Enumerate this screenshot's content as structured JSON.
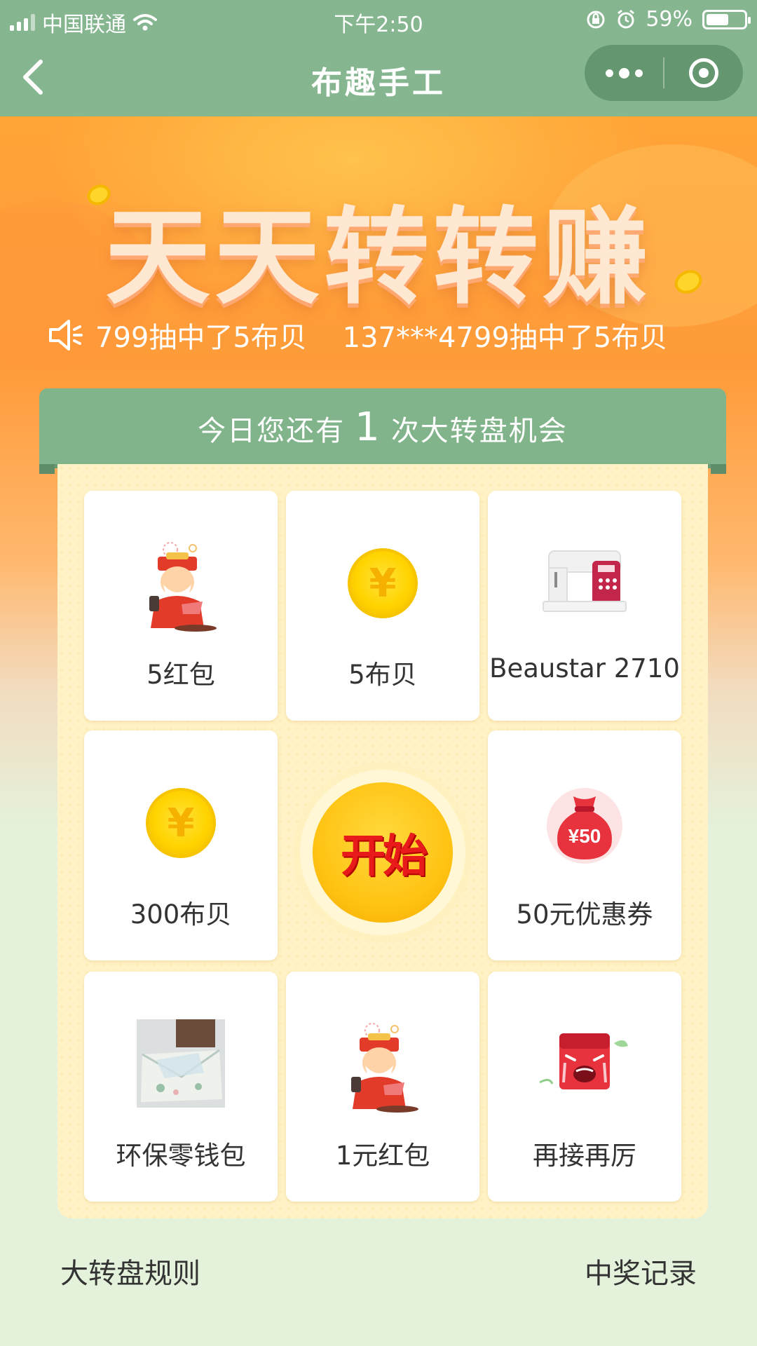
{
  "status_bar": {
    "carrier": "中国联通",
    "time": "下午2:50",
    "battery": "59%",
    "battery_level": 0.59
  },
  "nav": {
    "title": "布趣手工",
    "back_icon": "chevron-left-icon",
    "more_icon": "more-dots-icon",
    "close_icon": "target-ring-icon"
  },
  "hero": {
    "headline": "天天转转赚",
    "marquee": "799抽中了5布贝    137***4799抽中了5布贝"
  },
  "chances": {
    "prefix": "今日您还有",
    "count": "1",
    "suffix": "次大转盘机会"
  },
  "prizes": [
    {
      "label": "5红包",
      "icon": "fortune-god-icon"
    },
    {
      "label": "5布贝",
      "icon": "yen-coin-icon"
    },
    {
      "label": "Beaustar 2710",
      "icon": "sewing-machine-icon"
    },
    {
      "label": "300布贝",
      "icon": "yen-coin-icon"
    },
    {
      "label": "50元优惠券",
      "icon": "money-bag-icon",
      "badge": "¥50"
    },
    {
      "label": "环保零钱包",
      "icon": "coin-purse-icon"
    },
    {
      "label": "1元红包",
      "icon": "fortune-god-icon"
    },
    {
      "label": "再接再厉",
      "icon": "crying-envelope-icon"
    }
  ],
  "start_label": "开始",
  "footer": {
    "rules": "大转盘规则",
    "records": "中奖记录"
  },
  "colors": {
    "nav_green": "#86b690",
    "banner_green": "#82b48c",
    "hero_orange": "#ffa437",
    "board_cream": "#fff2c6",
    "page_bg": "#e4f2dc"
  }
}
